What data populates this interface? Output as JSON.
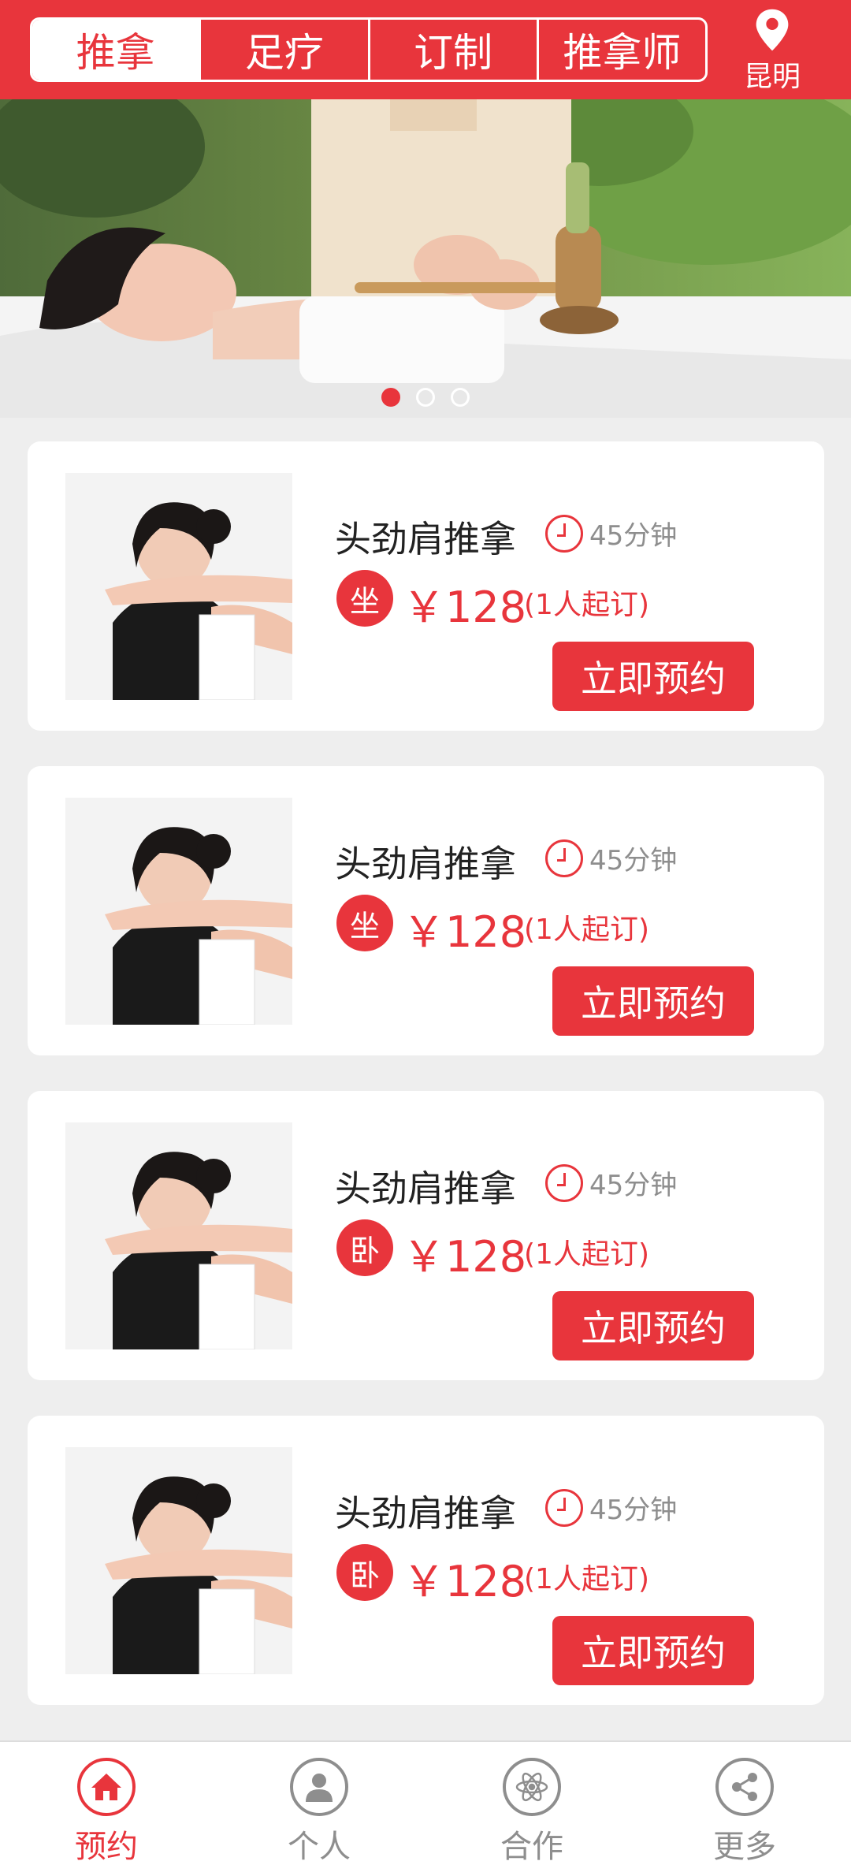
{
  "header": {
    "tabs": [
      {
        "label": "推拿",
        "active": true
      },
      {
        "label": "足疗",
        "active": false
      },
      {
        "label": "订制",
        "active": false
      },
      {
        "label": "推拿师",
        "active": false
      }
    ],
    "location": "昆明"
  },
  "banner": {
    "slides": 3,
    "active_slide": 1
  },
  "services": [
    {
      "name": "头劲肩推拿",
      "duration": "45分钟",
      "posture": "坐",
      "price": "￥128",
      "min_order": "(1人起订)",
      "button": "立即预约"
    },
    {
      "name": "头劲肩推拿",
      "duration": "45分钟",
      "posture": "坐",
      "price": "￥128",
      "min_order": "(1人起订)",
      "button": "立即预约"
    },
    {
      "name": "头劲肩推拿",
      "duration": "45分钟",
      "posture": "卧",
      "price": "￥128",
      "min_order": "(1人起订)",
      "button": "立即预约"
    },
    {
      "name": "头劲肩推拿",
      "duration": "45分钟",
      "posture": "卧",
      "price": "￥128",
      "min_order": "(1人起订)",
      "button": "立即预约"
    }
  ],
  "tabbar": [
    {
      "label": "预约",
      "icon": "home-icon",
      "active": true
    },
    {
      "label": "个人",
      "icon": "person-icon",
      "active": false
    },
    {
      "label": "合作",
      "icon": "atom-icon",
      "active": false
    },
    {
      "label": "更多",
      "icon": "share-icon",
      "active": false
    }
  ],
  "colors": {
    "accent": "#e8353c",
    "background": "#eeeeee",
    "muted_text": "#8e8e8e"
  }
}
